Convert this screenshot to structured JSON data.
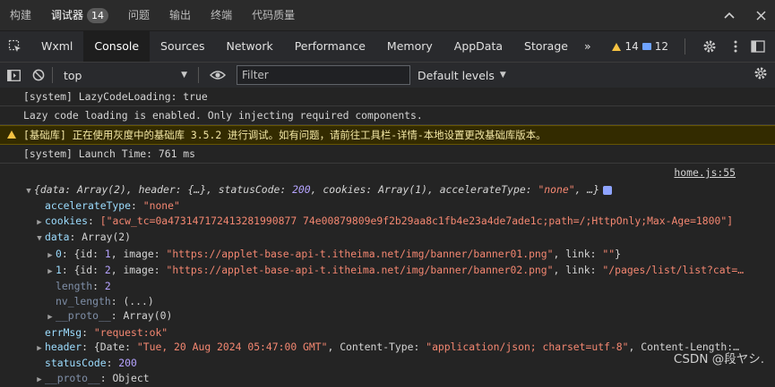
{
  "panel_tabs": [
    {
      "label": "构建"
    },
    {
      "label": "调试器",
      "badge": "14",
      "active": true
    },
    {
      "label": "问题"
    },
    {
      "label": "输出"
    },
    {
      "label": "终端"
    },
    {
      "label": "代码质量"
    }
  ],
  "devtools_tabs": [
    "Wxml",
    "Console",
    "Sources",
    "Network",
    "Performance",
    "Memory",
    "AppData",
    "Storage"
  ],
  "devtools_active": "Console",
  "overflow_label": "»",
  "counts": {
    "warnings": "14",
    "messages": "12"
  },
  "toolbar": {
    "context": "top",
    "filter_placeholder": "Filter",
    "levels": "Default levels"
  },
  "logs": [
    {
      "type": "log",
      "text": "[system] LazyCodeLoading: true"
    },
    {
      "type": "log",
      "text": "Lazy code loading is enabled. Only injecting required components."
    },
    {
      "type": "warn",
      "text": "[基础库] 正在使用灰度中的基础库 3.5.2 进行调试。如有问题，请前往工具栏-详情-本地设置更改基础库版本。"
    },
    {
      "type": "log",
      "text": "[system] Launch Time: 761 ms"
    }
  ],
  "object_log": {
    "source": "home.js:55",
    "summary": {
      "open": "{",
      "p1": "data",
      "v1": "Array(2)",
      "p2": "header",
      "v2": "{…}",
      "p3": "statusCode",
      "v3": "200",
      "p4": "cookies",
      "v4": "Array(1)",
      "p5": "accelerateType",
      "v5": "\"none\"",
      "tail": ", …}"
    },
    "accelerateType": {
      "key": "accelerateType",
      "value": "\"none\""
    },
    "cookies": {
      "key": "cookies",
      "value": "[\"acw_tc=0a473147172413281990877 74e00879809e9f2b29aa8c1fb4e23a4de7ade1c;path=/;HttpOnly;Max-Age=1800\"]"
    },
    "data": {
      "key": "data",
      "value": "Array(2)",
      "item0": {
        "index": "0",
        "id": "1",
        "image": "\"https://applet-base-api-t.itheima.net/img/banner/banner01.png\"",
        "link": "\"\""
      },
      "item1": {
        "index": "1",
        "id": "2",
        "image": "\"https://applet-base-api-t.itheima.net/img/banner/banner02.png\"",
        "link": "\"/pages/list/list?cat=…"
      },
      "length": {
        "key": "length",
        "value": "2"
      },
      "nv_length": {
        "key": "nv_length",
        "value": "(...)"
      },
      "proto": {
        "key": "__proto__",
        "value": "Array(0)"
      }
    },
    "errMsg": {
      "key": "errMsg",
      "value": "\"request:ok\""
    },
    "header": {
      "key": "header",
      "date": "\"Tue, 20 Aug 2024 05:47:00 GMT\"",
      "ctype": "\"application/json; charset=utf-8\"",
      "rest": "Content-Length:…"
    },
    "statusCode": {
      "key": "statusCode",
      "value": "200"
    },
    "proto": {
      "key": "__proto__",
      "value": "Object"
    }
  },
  "watermark": "CSDN @段ヤシ."
}
